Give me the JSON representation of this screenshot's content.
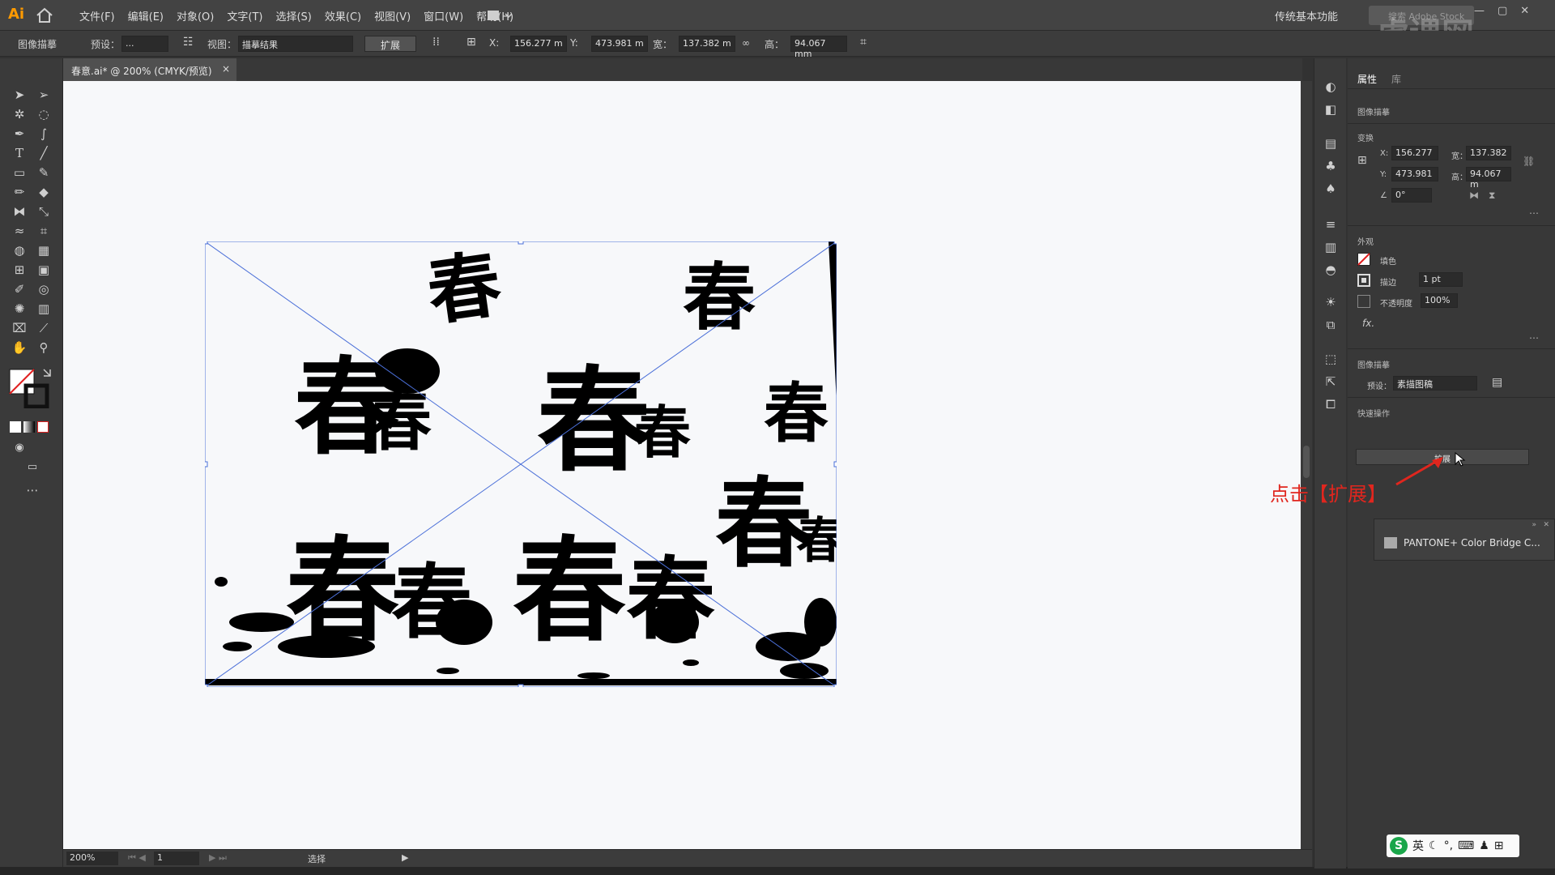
{
  "app": {
    "logo": "Ai"
  },
  "menu": [
    "文件(F)",
    "编辑(E)",
    "对象(O)",
    "文字(T)",
    "选择(S)",
    "效果(C)",
    "视图(V)",
    "窗口(W)",
    "帮助(H)"
  ],
  "workspace": "传统基本功能",
  "search_placeholder": "搜索 Adobe Stock",
  "control_bar": {
    "mode_label": "图像描摹",
    "preset_label": "预设：",
    "preset_value": "...",
    "view_label": "视图：",
    "view_value": "描摹结果",
    "expand_button": "扩展",
    "x_label": "X:",
    "x_value": "156.277 m",
    "y_label": "Y:",
    "y_value": "473.981 m",
    "w_label": "宽：",
    "w_value": "137.382 m",
    "h_label": "高：",
    "h_value": "94.067 mm"
  },
  "document_tab": {
    "title": "春意.ai* @ 200% (CMYK/预览)",
    "close": "×"
  },
  "status_bar": {
    "zoom": "200%",
    "page": "1",
    "tool": "选择"
  },
  "panel": {
    "tabs": [
      "属性",
      "库"
    ],
    "section_trace_title": "图像描摹",
    "section_transform": "变换",
    "x_label": "X:",
    "x_value": "156.277",
    "y_label": "Y:",
    "y_value": "473.981",
    "w_label": "宽：",
    "w_value": "137.382",
    "h_label": "高：",
    "h_value": "94.067 m",
    "angle_value": "0°",
    "section_appearance": "外观",
    "fill_label": "填色",
    "stroke_label": "描边",
    "stroke_value": "1 pt",
    "opacity_label": "不透明度",
    "opacity_value": "100%",
    "fx_label": "fx.",
    "section_trace": "图像描摹",
    "preset_label": "预设：",
    "preset_value": "素描图稿",
    "section_quick": "快速操作",
    "expand_button": "扩展"
  },
  "pantone_panel": {
    "label": "PANTONE+ Color Bridge C..."
  },
  "annotation": "点击【扩展】",
  "watermark": "虎课网",
  "ime": {
    "logo": "S",
    "lang": "英"
  },
  "accent_colors": {
    "selection": "#4a6fd8",
    "annotation": "#e0261e",
    "logo": "#ff9a00"
  }
}
